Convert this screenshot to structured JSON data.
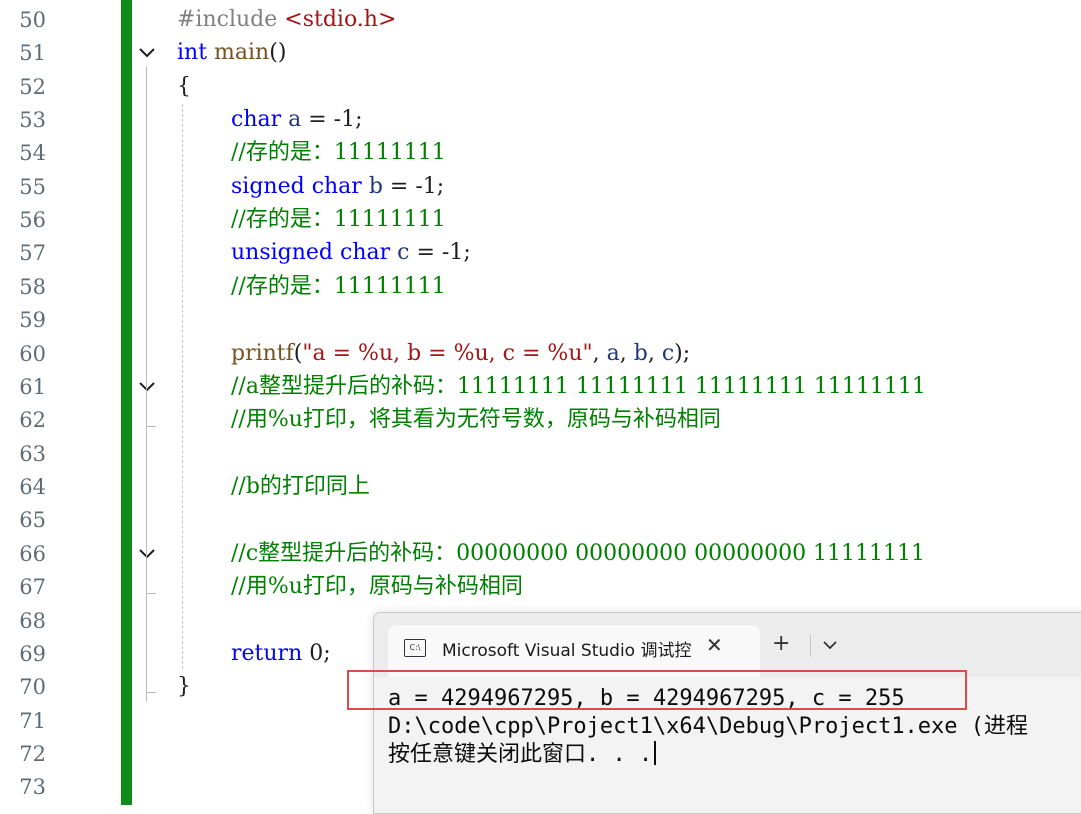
{
  "editor": {
    "line_numbers": [
      "50",
      "51",
      "52",
      "53",
      "54",
      "55",
      "56",
      "57",
      "58",
      "59",
      "60",
      "61",
      "62",
      "63",
      "64",
      "65",
      "66",
      "67",
      "68",
      "69",
      "70",
      "71",
      "72",
      "73"
    ],
    "code": {
      "l50_pp": "#include ",
      "l50_inc": "<stdio.h>",
      "l51_kw": "int",
      "l51_fn": "main",
      "l51_rest": "()",
      "l52": "{",
      "l53_kw": "char",
      "l53_id": "a",
      "l53_rest": " = -1;",
      "l54": "//存的是：11111111",
      "l55_kw1": "signed",
      "l55_kw2": "char",
      "l55_id": "b",
      "l55_rest": " = -1;",
      "l56": "//存的是：11111111",
      "l57_kw1": "unsigned",
      "l57_kw2": "char",
      "l57_id": "c",
      "l57_rest": " = -1;",
      "l58": "//存的是：11111111",
      "l60_fn": "printf",
      "l60_open": "(",
      "l60_str": "\"a = %u, b = %u, c = %u\"",
      "l60_sep1": ", ",
      "l60_a": "a",
      "l60_sep2": ", ",
      "l60_b": "b",
      "l60_sep3": ", ",
      "l60_c": "c",
      "l60_close": ");",
      "l61": "//a整型提升后的补码：11111111 11111111 11111111 11111111",
      "l62": "//用%u打印，将其看为无符号数，原码与补码相同",
      "l64": "//b的打印同上",
      "l66": "//c整型提升后的补码：00000000 00000000 00000000 11111111",
      "l67": "//用%u打印，原码与补码相同",
      "l69_kw": "return",
      "l69_rest": " 0;",
      "l70": "}"
    }
  },
  "console": {
    "tab_icon": "C:\\",
    "tab_title": "Microsoft Visual Studio 调试控",
    "close_glyph": "✕",
    "new_tab_glyph": "+",
    "output_line1": "a = 4294967295, b = 4294967295, c = 255",
    "output_line2": "D:\\code\\cpp\\Project1\\x64\\Debug\\Project1.exe (进程",
    "output_line3": "按任意键关闭此窗口. . ."
  },
  "colors": {
    "change_bar": "#108a18",
    "highlight_box": "#e04a4a"
  }
}
